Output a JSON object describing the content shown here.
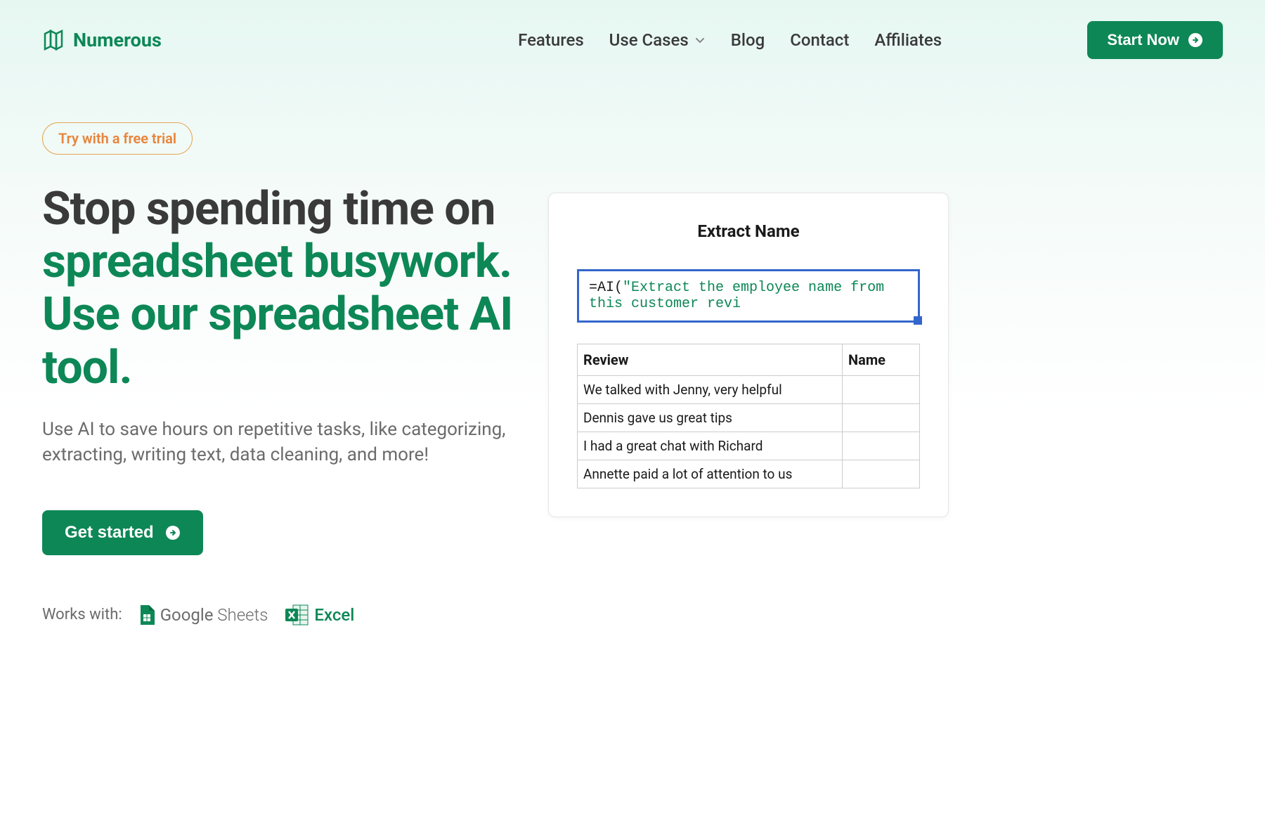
{
  "header": {
    "brand": "Numerous",
    "nav": {
      "features": "Features",
      "use_cases": "Use Cases",
      "blog": "Blog",
      "contact": "Contact",
      "affiliates": "Affiliates"
    },
    "cta": "Start Now"
  },
  "hero": {
    "badge": "Try with a free trial",
    "heading_part1": "Stop spending time on ",
    "heading_green": "spreadsheet busywork. Use our spreadsheet AI tool.",
    "subtext": "Use AI to save hours on repetitive tasks, like categorizing, extracting, writing text, data cleaning, and more!",
    "get_started": "Get started"
  },
  "works_with": {
    "label": "Works with:",
    "google": "Google",
    "sheets": " Sheets",
    "excel": "Excel"
  },
  "demo": {
    "title": "Extract Name",
    "formula_prefix": "=AI(",
    "formula_text": "\"Extract the employee name from this customer revi",
    "headers": {
      "review": "Review",
      "name": "Name"
    },
    "rows": [
      {
        "review": "We talked with Jenny, very helpful",
        "name": ""
      },
      {
        "review": "Dennis gave us great tips",
        "name": ""
      },
      {
        "review": "I had a great chat with Richard",
        "name": ""
      },
      {
        "review": "Annette paid a lot of attention to us",
        "name": ""
      }
    ]
  }
}
